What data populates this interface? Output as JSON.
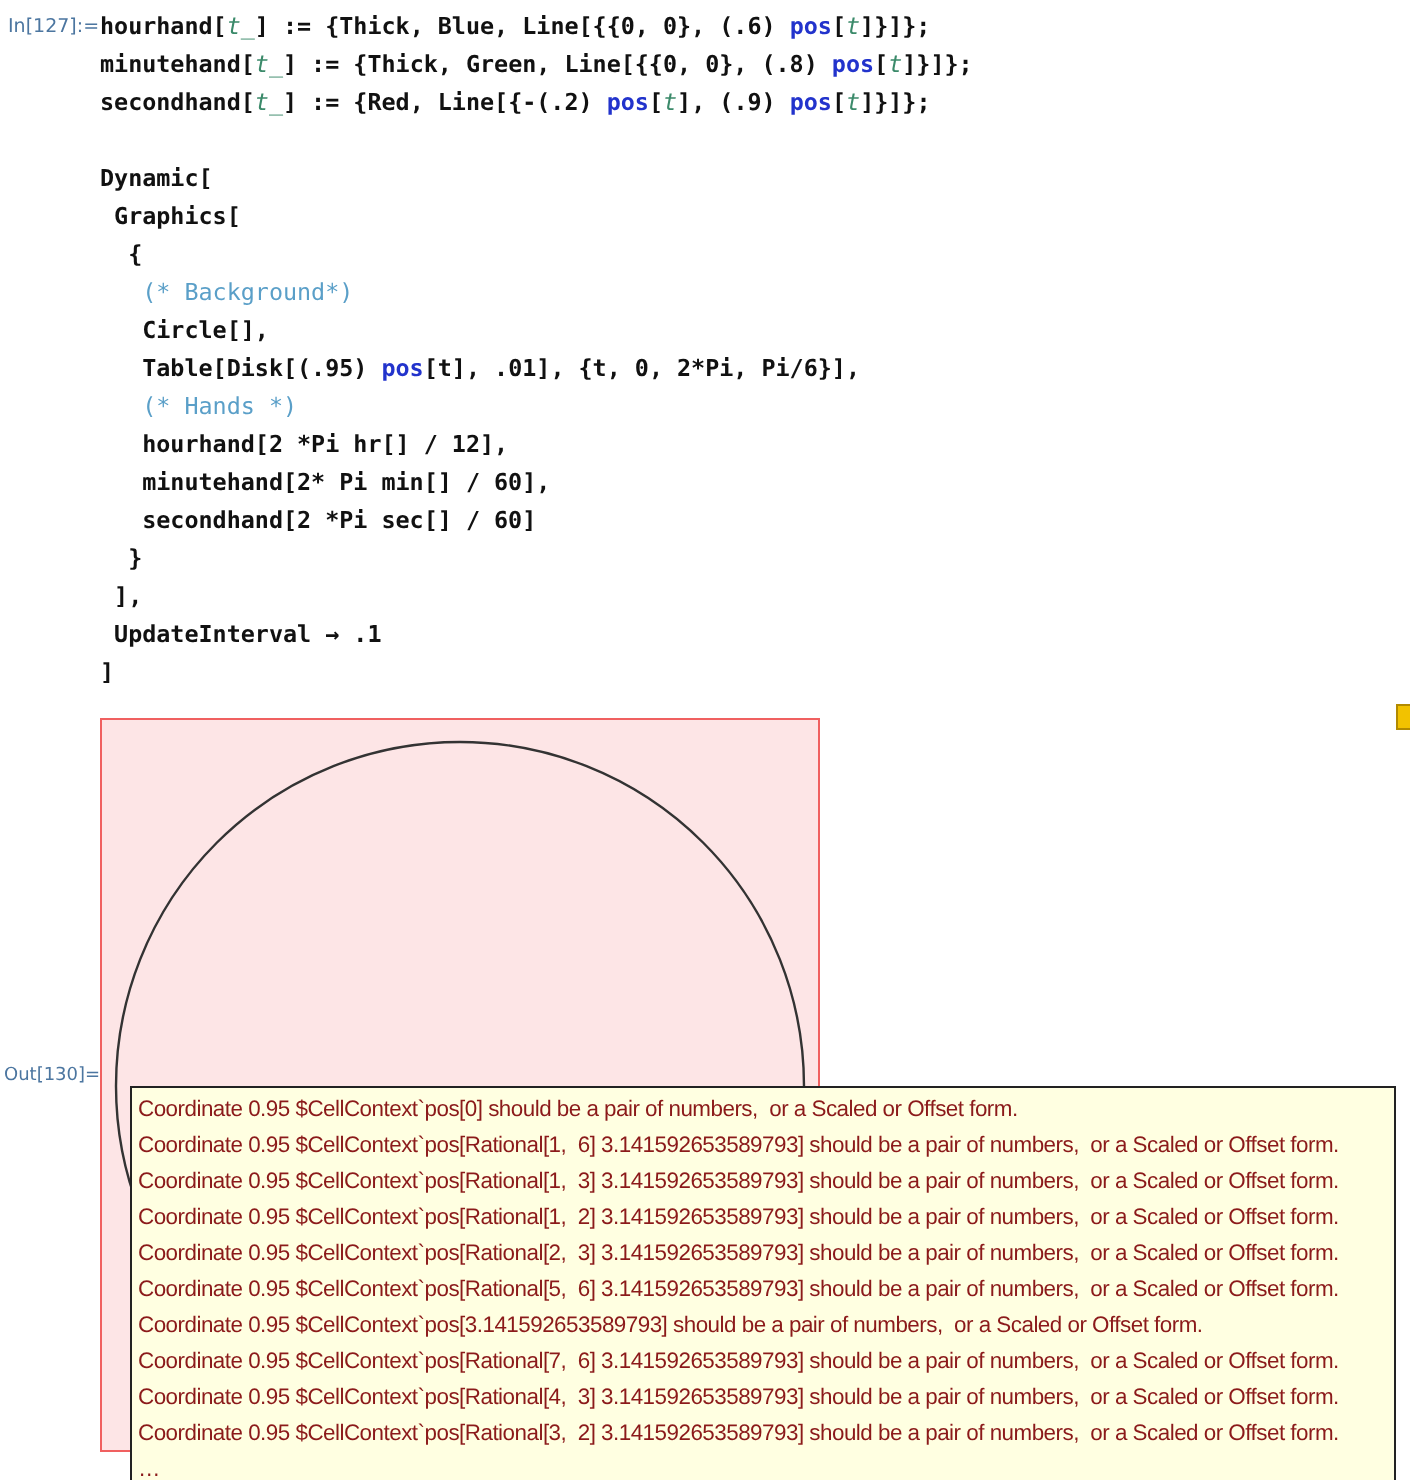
{
  "input_cell": {
    "label": "In[127]:=",
    "blocks": [
      [
        [
          {
            "kind": "code",
            "text": "hourhand["
          },
          {
            "kind": "pattern",
            "text": "t_"
          },
          {
            "kind": "code",
            "text": "] := {Thick, Blue, Line[{{0, 0}, (.6) "
          },
          {
            "kind": "symbol",
            "text": "pos"
          },
          {
            "kind": "code",
            "text": "["
          },
          {
            "kind": "pattern",
            "text": "t"
          },
          {
            "kind": "code",
            "text": "]}]};"
          }
        ],
        [
          {
            "kind": "code",
            "text": "minutehand["
          },
          {
            "kind": "pattern",
            "text": "t_"
          },
          {
            "kind": "code",
            "text": "] := {Thick, Green, Line[{{0, 0}, (.8) "
          },
          {
            "kind": "symbol",
            "text": "pos"
          },
          {
            "kind": "code",
            "text": "["
          },
          {
            "kind": "pattern",
            "text": "t"
          },
          {
            "kind": "code",
            "text": "]}]};"
          }
        ],
        [
          {
            "kind": "code",
            "text": "secondhand["
          },
          {
            "kind": "pattern",
            "text": "t_"
          },
          {
            "kind": "code",
            "text": "] := {Red, Line[{-(.2) "
          },
          {
            "kind": "symbol",
            "text": "pos"
          },
          {
            "kind": "code",
            "text": "["
          },
          {
            "kind": "pattern",
            "text": "t"
          },
          {
            "kind": "code",
            "text": "], (.9) "
          },
          {
            "kind": "symbol",
            "text": "pos"
          },
          {
            "kind": "code",
            "text": "["
          },
          {
            "kind": "pattern",
            "text": "t"
          },
          {
            "kind": "code",
            "text": "]}]};"
          }
        ]
      ],
      [
        [
          {
            "kind": "code",
            "text": "Dynamic["
          }
        ],
        [
          {
            "kind": "code",
            "text": " Graphics["
          }
        ],
        [
          {
            "kind": "code",
            "text": "  {"
          }
        ],
        [
          {
            "kind": "comment",
            "text": "   (* Background*)"
          }
        ],
        [
          {
            "kind": "code",
            "text": "   Circle[],"
          }
        ],
        [
          {
            "kind": "code",
            "text": "   Table[Disk[(.95) "
          },
          {
            "kind": "symbol",
            "text": "pos"
          },
          {
            "kind": "code",
            "text": "[t], .01], {t, 0, 2*Pi, Pi/6}],"
          }
        ],
        [
          {
            "kind": "comment",
            "text": "   (* Hands *)"
          }
        ],
        [
          {
            "kind": "code",
            "text": "   hourhand[2 *Pi hr[] / 12],"
          }
        ],
        [
          {
            "kind": "code",
            "text": "   minutehand[2* Pi min[] / 60],"
          }
        ],
        [
          {
            "kind": "code",
            "text": "   secondhand[2 *Pi sec[] / 60]"
          }
        ],
        [
          {
            "kind": "code",
            "text": "  }"
          }
        ],
        [
          {
            "kind": "code",
            "text": " ],"
          }
        ],
        [
          {
            "kind": "code",
            "text": " UpdateInterval → .1"
          }
        ],
        [
          {
            "kind": "code",
            "text": "]"
          }
        ]
      ]
    ]
  },
  "output_cell": {
    "label": "Out[130]=",
    "messages": [
      "Coordinate 0.95 $CellContext`pos[0] should be a pair of numbers,  or a Scaled or Offset form.",
      "Coordinate 0.95 $CellContext`pos[Rational[1,  6] 3.141592653589793] should be a pair of numbers,  or a Scaled or Offset form.",
      "Coordinate 0.95 $CellContext`pos[Rational[1,  3] 3.141592653589793] should be a pair of numbers,  or a Scaled or Offset form.",
      "Coordinate 0.95 $CellContext`pos[Rational[1,  2] 3.141592653589793] should be a pair of numbers,  or a Scaled or Offset form.",
      "Coordinate 0.95 $CellContext`pos[Rational[2,  3] 3.141592653589793] should be a pair of numbers,  or a Scaled or Offset form.",
      "Coordinate 0.95 $CellContext`pos[Rational[5,  6] 3.141592653589793] should be a pair of numbers,  or a Scaled or Offset form.",
      "Coordinate 0.95 $CellContext`pos[3.141592653589793] should be a pair of numbers,  or a Scaled or Offset form.",
      "Coordinate 0.95 $CellContext`pos[Rational[7,  6] 3.141592653589793] should be a pair of numbers,  or a Scaled or Offset form.",
      "Coordinate 0.95 $CellContext`pos[Rational[4,  3] 3.141592653589793] should be a pair of numbers,  or a Scaled or Offset form.",
      "Coordinate 0.95 $CellContext`pos[Rational[3,  2] 3.141592653589793] should be a pair of numbers,  or a Scaled or Offset form.",
      "…"
    ]
  }
}
